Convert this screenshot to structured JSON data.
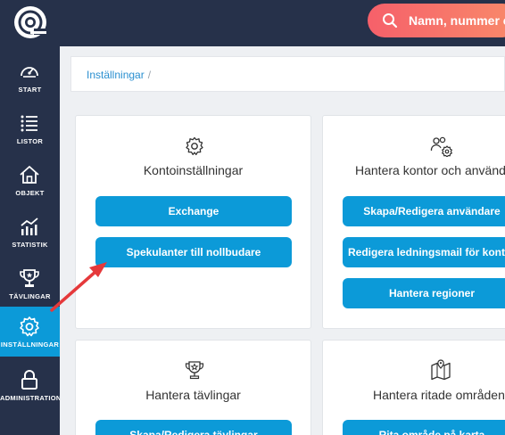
{
  "search": {
    "placeholder": "Namn, nummer eller"
  },
  "sidebar": {
    "items": [
      {
        "label": "START",
        "icon": "gauge-icon"
      },
      {
        "label": "LISTOR",
        "icon": "list-icon"
      },
      {
        "label": "OBJEKT",
        "icon": "house-icon"
      },
      {
        "label": "STATISTIK",
        "icon": "chart-icon"
      },
      {
        "label": "TÄVLINGAR",
        "icon": "trophy-icon"
      },
      {
        "label": "INSTÄLLNINGAR",
        "icon": "gear-icon",
        "active": true
      },
      {
        "label": "ADMINISTRATION",
        "icon": "lock-icon"
      }
    ]
  },
  "breadcrumb": {
    "item": "Inställningar",
    "separator": "/"
  },
  "cards": [
    {
      "title": "Kontoinställningar",
      "icon": "gear-icon",
      "buttons": [
        "Exchange",
        "Spekulanter till nollbudare"
      ]
    },
    {
      "title": "Hantera kontor och användare",
      "icon": "users-gear-icon",
      "buttons": [
        "Skapa/Redigera användare",
        "Redigera ledningsmail för kontor",
        "Hantera regioner"
      ]
    },
    {
      "title": "Hantera tävlingar",
      "icon": "trophy-icon",
      "buttons": [
        "Skapa/Redigera tävlingar"
      ]
    },
    {
      "title": "Hantera ritade områden",
      "icon": "map-icon",
      "buttons": [
        "Rita område på karta"
      ]
    }
  ],
  "colors": {
    "sidebar": "#26314a",
    "accent": "#0c9ad8",
    "search": "#f6606a",
    "annotation_arrow": "#e5393b"
  }
}
